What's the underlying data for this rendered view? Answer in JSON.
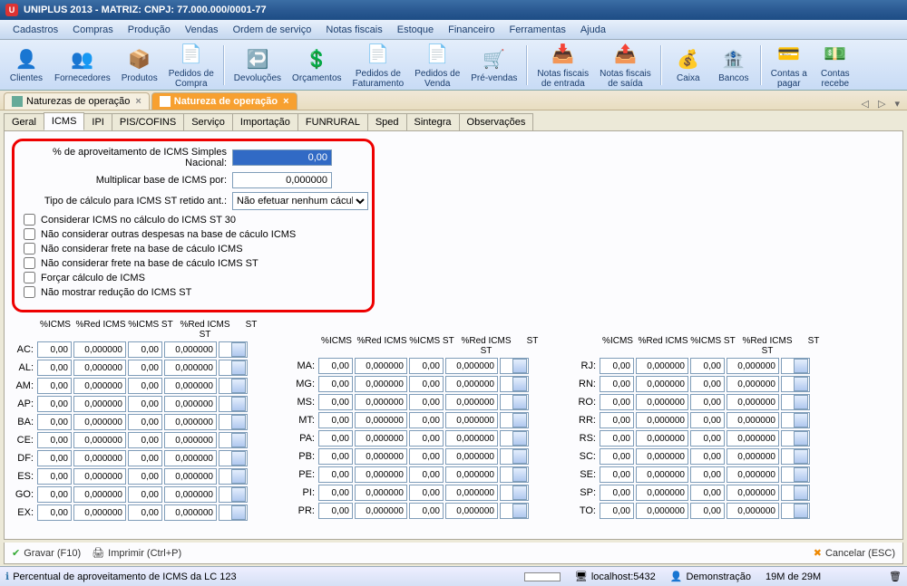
{
  "title": "UNIPLUS  2013 - MATRIZ:          CNPJ: 77.000.000/0001-77",
  "menu": [
    "Cadastros",
    "Compras",
    "Produção",
    "Vendas",
    "Ordem de serviço",
    "Notas fiscais",
    "Estoque",
    "Financeiro",
    "Ferramentas",
    "Ajuda"
  ],
  "toolbar": [
    {
      "icon": "👤",
      "label": "Clientes"
    },
    {
      "icon": "👥",
      "label": "Fornecedores"
    },
    {
      "icon": "📦",
      "label": "Produtos"
    },
    {
      "icon": "📄",
      "label": "Pedidos de\nCompra"
    },
    {
      "sep": true
    },
    {
      "icon": "↩️",
      "label": "Devoluções"
    },
    {
      "icon": "💲",
      "label": "Orçamentos"
    },
    {
      "icon": "📄",
      "label": "Pedidos de\nFaturamento"
    },
    {
      "icon": "📄",
      "label": "Pedidos de\nVenda"
    },
    {
      "icon": "🛒",
      "label": "Pré-vendas"
    },
    {
      "sep": true
    },
    {
      "icon": "📥",
      "label": "Notas fiscais\nde entrada"
    },
    {
      "icon": "📤",
      "label": "Notas fiscais\nde saída"
    },
    {
      "sep": true
    },
    {
      "icon": "💰",
      "label": "Caixa"
    },
    {
      "icon": "🏦",
      "label": "Bancos"
    },
    {
      "sep": true
    },
    {
      "icon": "💳",
      "label": "Contas a\npagar"
    },
    {
      "icon": "💵",
      "label": "Contas\nrecebe"
    }
  ],
  "doctabs": [
    {
      "label": "Naturezas de operação",
      "active": false
    },
    {
      "label": "Natureza de operação",
      "active": true
    }
  ],
  "innertabs": [
    "Geral",
    "ICMS",
    "IPI",
    "PIS/COFINS",
    "Serviço",
    "Importação",
    "FUNRURAL",
    "Sped",
    "Sintegra",
    "Observações"
  ],
  "innertab_active": 1,
  "form": {
    "lbl_aprov": "% de aproveitamento de ICMS Simples Nacional:",
    "val_aprov": "0,00",
    "lbl_mult": "Multiplicar base de ICMS por:",
    "val_mult": "0,000000",
    "lbl_tipo": "Tipo de cálculo para ICMS ST retido ant.:",
    "val_tipo": "Não efetuar nenhum cáculo",
    "checks": [
      "Considerar ICMS no cálculo do ICMS ST 30",
      "Não considerar outras despesas na base de cáculo ICMS",
      "Não considerar frete na base de cáculo ICMS",
      "Não considerar frete na base de cáculo ICMS ST",
      "Forçar cálculo de ICMS",
      "Não mostrar redução do ICMS ST"
    ]
  },
  "grid_headers": [
    "%ICMS",
    "%Red ICMS",
    "%ICMS ST",
    "%Red ICMS ST",
    "ST"
  ],
  "states_col1": [
    "AC",
    "AL",
    "AM",
    "AP",
    "BA",
    "CE",
    "DF",
    "ES",
    "GO",
    "EX"
  ],
  "states_col2": [
    "MA",
    "MG",
    "MS",
    "MT",
    "PA",
    "PB",
    "PE",
    "PI",
    "PR"
  ],
  "states_col3": [
    "RJ",
    "RN",
    "RO",
    "RR",
    "RS",
    "SC",
    "SE",
    "SP",
    "TO"
  ],
  "cell_v1": "0,00",
  "cell_v2": "0,000000",
  "actions": {
    "gravar": "Gravar (F10)",
    "imprimir": "Imprimir (Ctrl+P)",
    "cancelar": "Cancelar (ESC)"
  },
  "status": {
    "hint": "Percentual de aproveitamento de ICMS da LC 123",
    "host": "localhost:5432",
    "user": "Demonstração",
    "mem": "19M de 29M"
  }
}
